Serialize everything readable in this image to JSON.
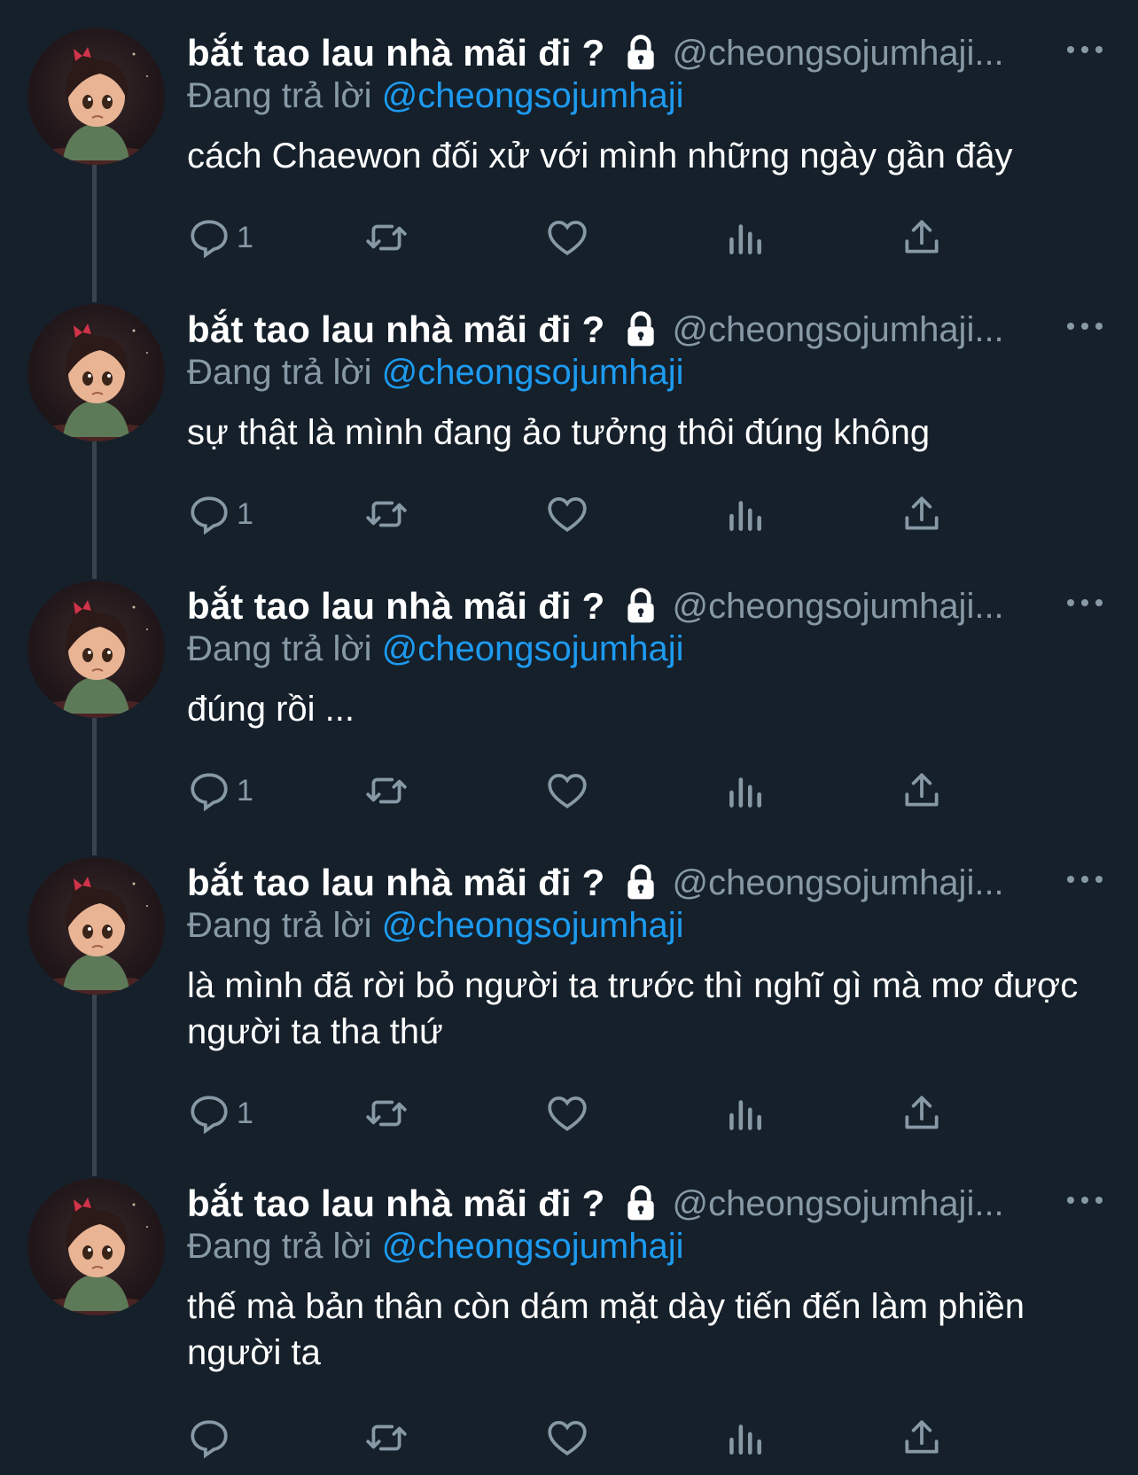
{
  "colors": {
    "background": "#15202b",
    "text": "#ffffff",
    "muted": "#8899a6",
    "link": "#1d9bf0",
    "thread_line": "#38444d"
  },
  "tweets": [
    {
      "name": "bắt tao lau nhà mãi đi ?",
      "handle": "@cheongsojumhaji...",
      "reply_prefix": "Đang trả lời",
      "reply_to": "@cheongsojumhaji",
      "text": "cách Chaewon đối xử với mình những ngày gần đây",
      "reply_count": "1"
    },
    {
      "name": "bắt tao lau nhà mãi đi ?",
      "handle": "@cheongsojumhaji...",
      "reply_prefix": "Đang trả lời",
      "reply_to": "@cheongsojumhaji",
      "text": "sự thật là mình đang ảo tưởng thôi đúng không",
      "reply_count": "1"
    },
    {
      "name": "bắt tao lau nhà mãi đi ?",
      "handle": "@cheongsojumhaji...",
      "reply_prefix": "Đang trả lời",
      "reply_to": "@cheongsojumhaji",
      "text": "đúng rồi ...",
      "reply_count": "1"
    },
    {
      "name": "bắt tao lau nhà mãi đi ?",
      "handle": "@cheongsojumhaji...",
      "reply_prefix": "Đang trả lời",
      "reply_to": "@cheongsojumhaji",
      "text": "là mình đã rời bỏ người ta trước thì nghĩ gì mà mơ được người ta tha thứ",
      "reply_count": "1"
    },
    {
      "name": "bắt tao lau nhà mãi đi ?",
      "handle": "@cheongsojumhaji...",
      "reply_prefix": "Đang trả lời",
      "reply_to": "@cheongsojumhaji",
      "text": "thế mà bản thân còn dám mặt dày tiến đến làm phiền người ta",
      "reply_count": ""
    }
  ],
  "icons": {
    "lock": "lock-icon",
    "more": "more-icon",
    "reply": "reply-icon",
    "retweet": "retweet-icon",
    "like": "heart-icon",
    "analytics": "analytics-icon",
    "share": "share-icon"
  }
}
